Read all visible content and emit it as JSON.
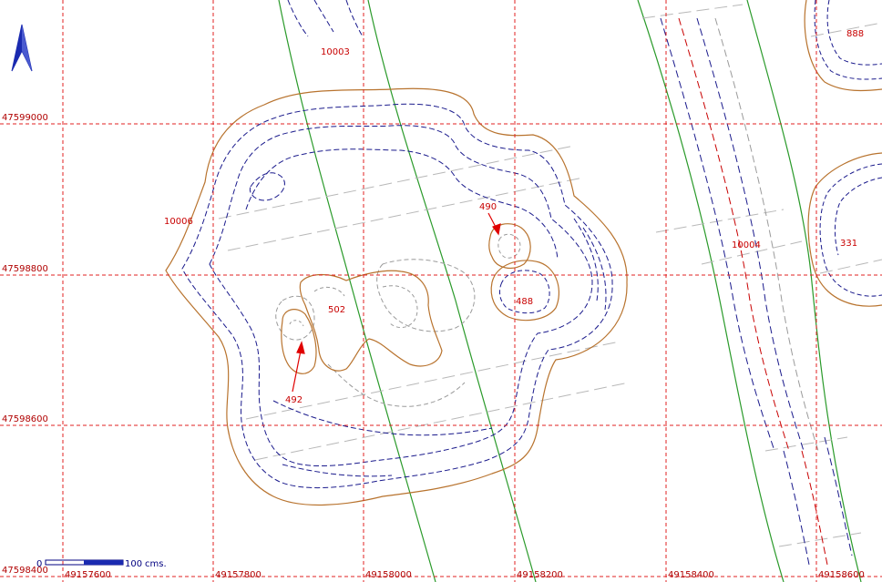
{
  "map": {
    "colors": {
      "grid": "#e02020",
      "grid_label": "#b00000",
      "boundary": "#b8732e",
      "contour": "#1a1a8c",
      "contour_light": "#9a9a9a",
      "trench": "#b8b8b8",
      "channel": "#2a9a2a",
      "label": "#c80000",
      "arrow": "#e00000",
      "north": "#1a2ab0"
    },
    "north_arrow_icon": "north-arrow-icon",
    "grid": {
      "northings": [
        "47599000",
        "47598800",
        "47598600",
        "47598400"
      ],
      "eastings": [
        "49157600",
        "49157800",
        "49158000",
        "49158200",
        "49158400",
        "49158600"
      ]
    },
    "features": {
      "f10003": "10003",
      "f10006": "10006",
      "f490": "490",
      "f488": "488",
      "f502": "502",
      "f492": "492",
      "f10004": "10004",
      "f331": "331",
      "f888": "888"
    },
    "scale": {
      "start": "0",
      "end": "100",
      "unit": "cms."
    }
  }
}
